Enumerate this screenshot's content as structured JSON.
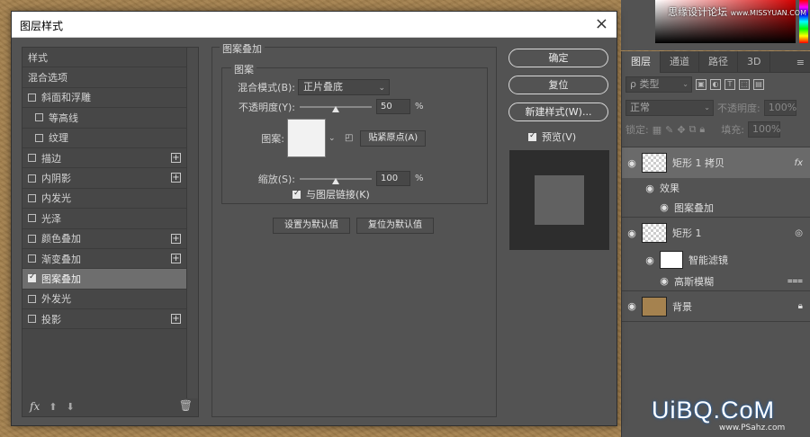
{
  "dialog": {
    "title": "图层样式",
    "close_label": "×"
  },
  "style_list": {
    "items": [
      {
        "label": "样式",
        "checkbox": false,
        "plus": false,
        "checked": false
      },
      {
        "label": "混合选项",
        "checkbox": false,
        "plus": false,
        "checked": false
      },
      {
        "label": "斜面和浮雕",
        "checkbox": true,
        "plus": false,
        "checked": false
      },
      {
        "label": "等高线",
        "checkbox": true,
        "plus": false,
        "checked": false,
        "sub": true
      },
      {
        "label": "纹理",
        "checkbox": true,
        "plus": false,
        "checked": false,
        "sub": true
      },
      {
        "label": "描边",
        "checkbox": true,
        "plus": true,
        "checked": false
      },
      {
        "label": "内阴影",
        "checkbox": true,
        "plus": true,
        "checked": false
      },
      {
        "label": "内发光",
        "checkbox": true,
        "plus": false,
        "checked": false
      },
      {
        "label": "光泽",
        "checkbox": true,
        "plus": false,
        "checked": false
      },
      {
        "label": "颜色叠加",
        "checkbox": true,
        "plus": true,
        "checked": false
      },
      {
        "label": "渐变叠加",
        "checkbox": true,
        "plus": true,
        "checked": false
      },
      {
        "label": "图案叠加",
        "checkbox": true,
        "plus": false,
        "checked": true,
        "active": true
      },
      {
        "label": "外发光",
        "checkbox": true,
        "plus": false,
        "checked": false
      },
      {
        "label": "投影",
        "checkbox": true,
        "plus": true,
        "checked": false
      }
    ],
    "footer_fx": "fx"
  },
  "pattern_overlay": {
    "section_title": "图案叠加",
    "group_title": "图案",
    "blend_mode_label": "混合模式(B):",
    "blend_mode_value": "正片叠底",
    "opacity_label": "不透明度(Y):",
    "opacity_value": "50",
    "opacity_level": 0.5,
    "pattern_label": "图案:",
    "snap_origin_label": "贴紧原点(A)",
    "scale_label": "缩放(S):",
    "scale_value": "100",
    "scale_level": 0.5,
    "percent": "%",
    "link_label": "与图层链接(K)",
    "link_checked": true,
    "set_default_label": "设置为默认值",
    "reset_default_label": "复位为默认值"
  },
  "buttons": {
    "ok": "确定",
    "reset": "复位",
    "new_style": "新建样式(W)...",
    "preview": "预览(V)",
    "preview_checked": true
  },
  "color_panel": {
    "watermark_main": "思缘设计论坛",
    "watermark_url": "www.MISSYUAN.COM"
  },
  "layers_panel": {
    "tabs": [
      "图层",
      "通道",
      "路径",
      "3D"
    ],
    "filter_label": "ρ 类型",
    "blend_mode": "正常",
    "opacity_label": "不透明度:",
    "opacity_value": "100%",
    "lock_label": "锁定:",
    "fill_label": "填充:",
    "fill_value": "100%",
    "layers": [
      {
        "name": "矩形 1 拷贝",
        "badge": "fx",
        "type": "big",
        "selected": true
      },
      {
        "name": "效果",
        "type": "effect"
      },
      {
        "name": "图案叠加",
        "type": "effect-sub"
      },
      {
        "name": "矩形 1",
        "type": "big"
      },
      {
        "name": "智能滤镜",
        "type": "filter"
      },
      {
        "name": "高斯模糊",
        "type": "filter-sub"
      },
      {
        "name": "背景",
        "type": "bg"
      }
    ]
  },
  "logo": {
    "text": "UiBQ.CoM",
    "sub": "www.PSahz.com"
  }
}
